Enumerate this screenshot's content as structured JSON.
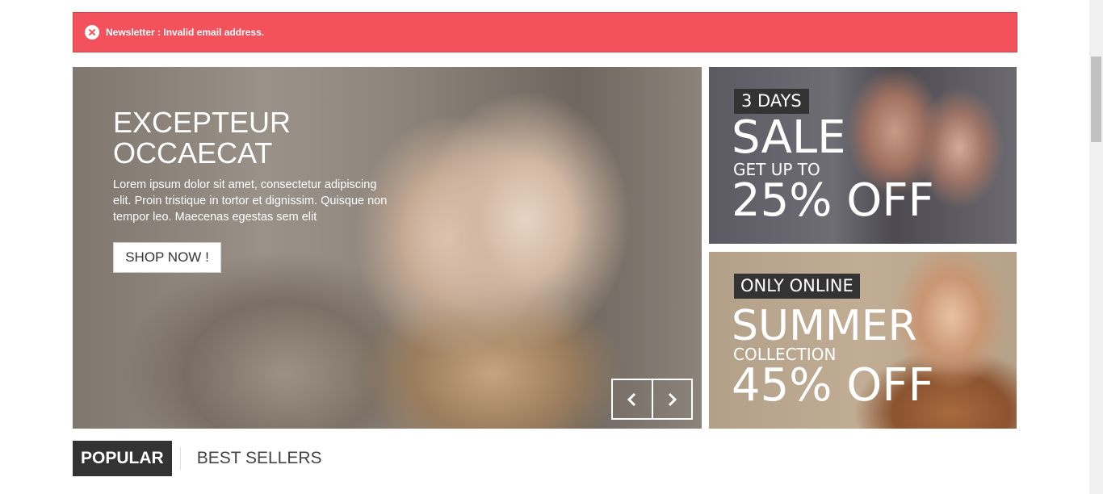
{
  "alert": {
    "message": "Newsletter : Invalid email address.",
    "icon": "close-circle-icon",
    "color": "#f3515c"
  },
  "slider": {
    "title": "EXCEPTEUR\nOCCAECAT",
    "description": "Lorem ipsum dolor sit amet, consectetur adipiscing elit. Proin tristique in tortor et dignissim. Quisque non tempor leo. Maecenas egestas sem elit",
    "button_label": "SHOP NOW !",
    "prev_icon": "chevron-left-icon",
    "next_icon": "chevron-right-icon"
  },
  "banners": [
    {
      "tag": "3 DAYS",
      "headline": "SALE",
      "subline": "GET UP TO",
      "offer": "25% OFF"
    },
    {
      "tag": "ONLY ONLINE",
      "headline": "SUMMER",
      "subline": "COLLECTION",
      "offer": "45% OFF"
    }
  ],
  "tabs": [
    {
      "label": "POPULAR",
      "active": true
    },
    {
      "label": "BEST SELLERS",
      "active": false
    }
  ]
}
